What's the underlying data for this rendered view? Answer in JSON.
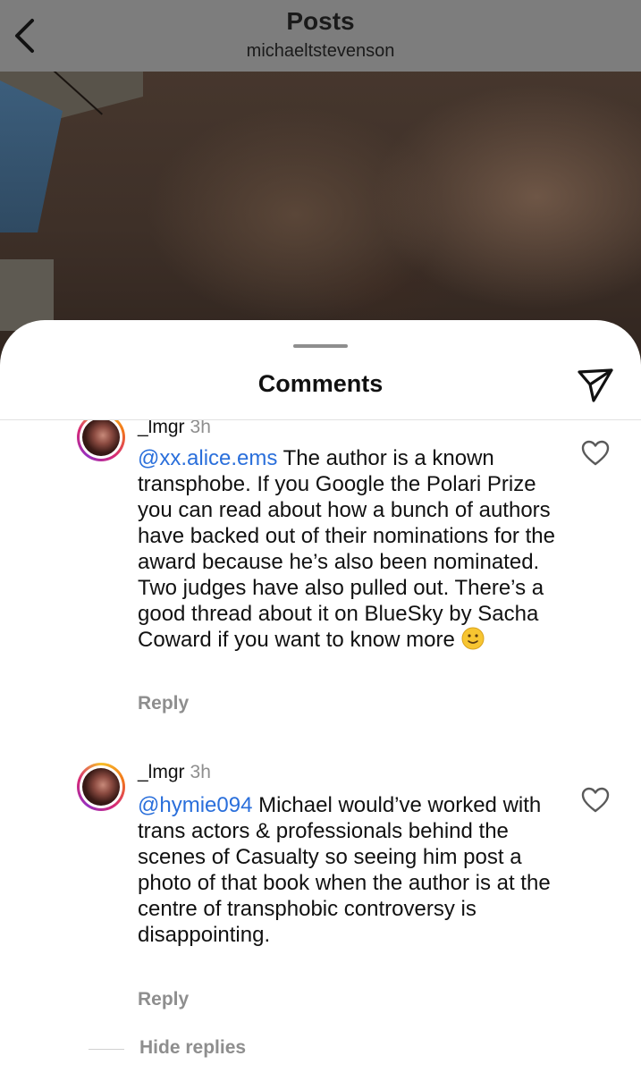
{
  "header": {
    "title": "Posts",
    "subtitle": "michaeltstevenson"
  },
  "sheet": {
    "title": "Comments"
  },
  "comments": [
    {
      "username": "_lmgr",
      "time": "3h",
      "mention": "@xx.alice.ems",
      "text": " The author is a known transphobe. If you Google the Polari Prize you can read about how a bunch of authors have backed out of their nominations for the award because he’s also been nominated. Two judges have also pulled out. There’s a good thread about it on BlueSky by Sacha Coward if you want to know more ",
      "emoji": "slightly-smiling-face",
      "reply_label": "Reply"
    },
    {
      "username": "_lmgr",
      "time": "3h",
      "mention": "@hymie094",
      "text": " Michael would’ve worked with trans actors & professionals behind the scenes of Casualty so seeing him post a photo of that book when the author is at the centre of transphobic controversy is disappointing.",
      "reply_label": "Reply"
    }
  ],
  "hide_replies_label": "Hide replies",
  "colors": {
    "mention": "#2a6fdb",
    "muted": "#8e8e8e",
    "header_bg": "#7d7d7d"
  },
  "icons": {
    "back": "chevron-left-icon",
    "send": "send-paper-plane-icon",
    "like": "heart-outline-icon"
  }
}
